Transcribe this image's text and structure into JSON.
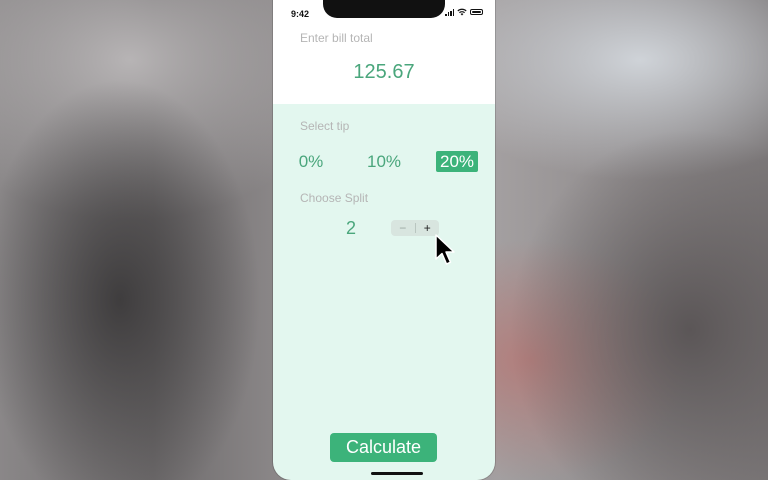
{
  "status_bar": {
    "time": "9:42",
    "icons": [
      "signal-icon",
      "wifi-icon",
      "battery-icon"
    ]
  },
  "bill": {
    "label": "Enter bill total",
    "value": "125.67"
  },
  "tip": {
    "label": "Select tip",
    "options": [
      "0%",
      "10%",
      "20%"
    ],
    "selected": "20%"
  },
  "split": {
    "label": "Choose Split",
    "value": "2",
    "stepper": {
      "minus": "−",
      "plus": "+"
    }
  },
  "actions": {
    "calculate_label": "Calculate"
  },
  "colors": {
    "accent": "#3cb37a",
    "text_green": "#4aa67c",
    "panel_bg": "#e3f7ef",
    "label_gray": "#b5b5b5"
  }
}
